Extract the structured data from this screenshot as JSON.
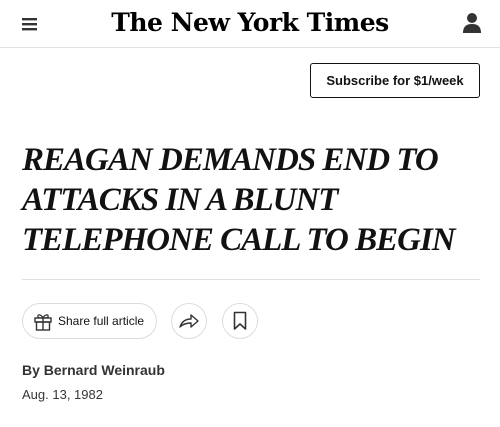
{
  "header": {
    "masthead": "The New York Times",
    "menu_icon": "hamburger-menu-icon",
    "account_icon": "user-account-icon"
  },
  "subscribe": {
    "label": "Subscribe for $1/week"
  },
  "article": {
    "headline_lines": [
      "REAGAN DEMANDS END TO",
      "ATTACKS IN A BLUNT",
      "TELEPHONE CALL TO BEGIN"
    ],
    "byline": "By Bernard Weinraub",
    "date": "Aug. 13, 1982"
  },
  "actions": {
    "share_label": "Share full article",
    "share_icon": "gift-icon",
    "forward_icon": "share-arrow-icon",
    "save_icon": "bookmark-icon"
  },
  "colors": {
    "text": "#121212",
    "divider": "#dfdfdf",
    "button_border": "#dcdcdc"
  }
}
